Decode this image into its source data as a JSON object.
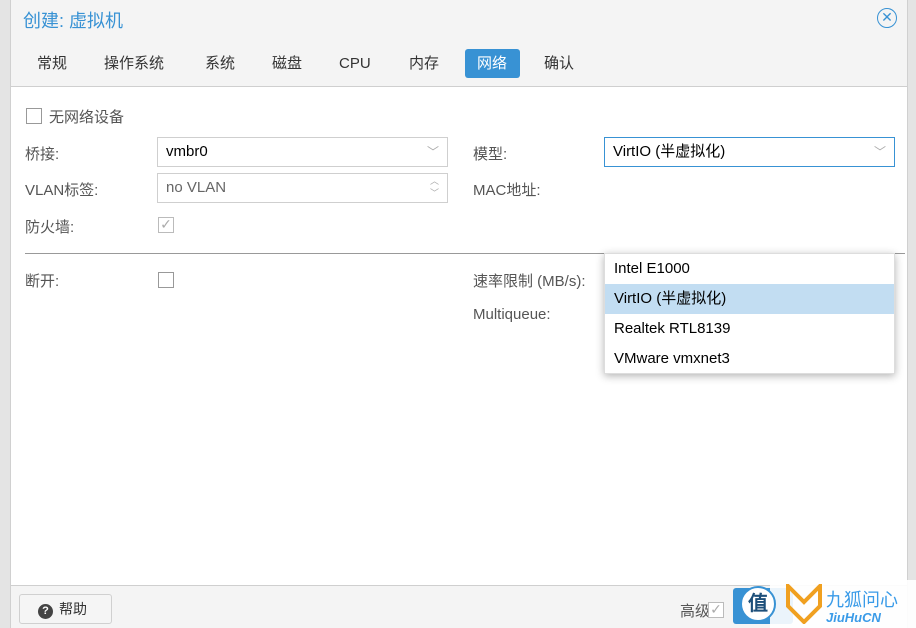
{
  "dialog": {
    "title": "创建: 虚拟机",
    "close_icon": "close-circle-icon"
  },
  "tabs": [
    {
      "label": "常规"
    },
    {
      "label": "操作系统"
    },
    {
      "label": "系统"
    },
    {
      "label": "磁盘"
    },
    {
      "label": "CPU"
    },
    {
      "label": "内存"
    },
    {
      "label": "网络",
      "active": true
    },
    {
      "label": "确认"
    }
  ],
  "form": {
    "no_network_label": "无网络设备",
    "no_network_checked": false,
    "bridge_label": "桥接:",
    "bridge_value": "vmbr0",
    "vlan_label": "VLAN标签:",
    "vlan_placeholder": "no VLAN",
    "firewall_label": "防火墙:",
    "firewall_checked": true,
    "model_label": "模型:",
    "model_value": "VirtIO (半虚拟化)",
    "mac_label": "MAC地址:",
    "disconnect_label": "断开:",
    "disconnect_checked": false,
    "rate_label": "速率限制 (MB/s):",
    "multiqueue_label": "Multiqueue:"
  },
  "model_options": [
    {
      "label": "Intel E1000"
    },
    {
      "label": "VirtIO (半虚拟化)",
      "selected": true
    },
    {
      "label": "Realtek RTL8139"
    },
    {
      "label": "VMware vmxnet3"
    }
  ],
  "footer": {
    "help_label": "帮助",
    "advanced_label": "高级",
    "advanced_checked": true
  },
  "watermark": {
    "circle_text": "值",
    "text": "九狐问心",
    "subtext": "JiuHuCN"
  },
  "colors": {
    "accent": "#3892d4",
    "selected_option": "#c2ddf2"
  }
}
